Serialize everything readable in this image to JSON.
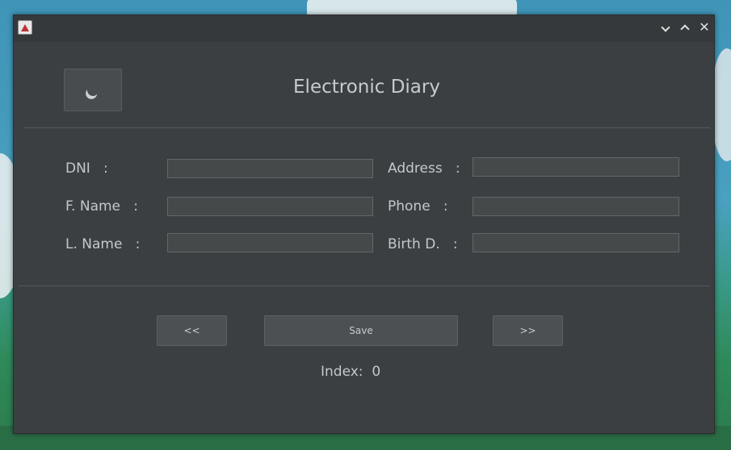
{
  "window": {
    "title": ""
  },
  "header": {
    "title": "Electronic Diary"
  },
  "form": {
    "dni_label": "DNI   :",
    "fname_label": "F. Name   :",
    "lname_label": "L. Name   :",
    "address_label": "Address   :",
    "phone_label": "Phone   :",
    "birth_label": "Birth D.   :",
    "dni_value": "",
    "fname_value": "",
    "lname_value": "",
    "address_value": "",
    "phone_value": "",
    "birth_value": ""
  },
  "nav": {
    "prev_label": "<<",
    "save_label": "Save",
    "next_label": ">>"
  },
  "status": {
    "index_label": "Index:",
    "index_value": "0"
  },
  "icons": {
    "app": "app-icon",
    "logo": "moon-icon",
    "minimize": "chevron-down-icon",
    "maximize": "chevron-up-icon",
    "close": "close-icon"
  }
}
